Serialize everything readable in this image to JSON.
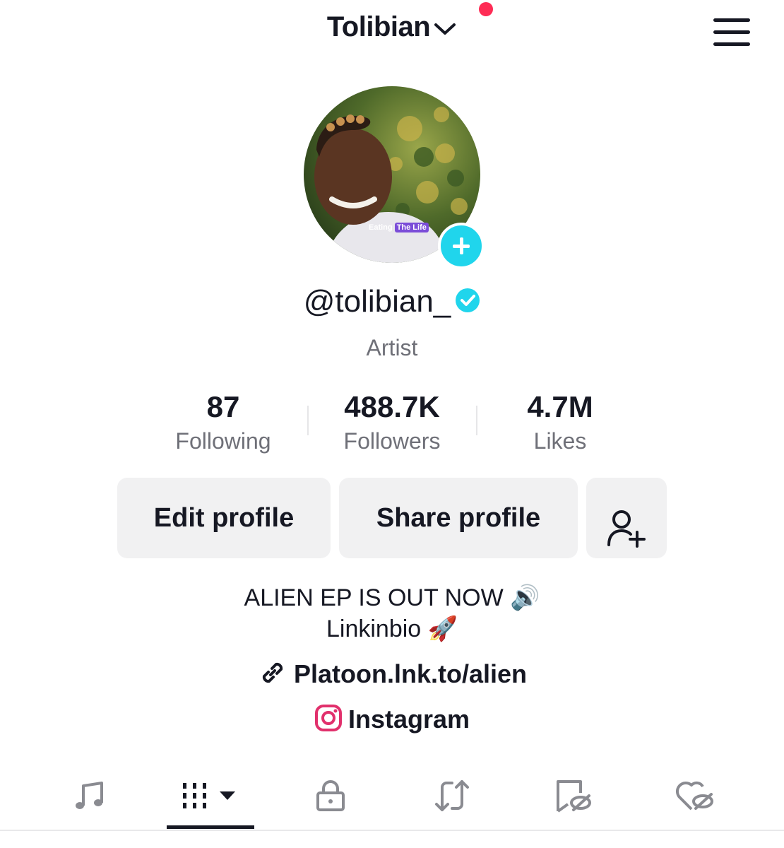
{
  "header": {
    "username": "Tolibian"
  },
  "avatar": {
    "caption_left": "Eating",
    "caption_badge": "The Life"
  },
  "profile": {
    "handle": "@tolibian_",
    "category": "Artist"
  },
  "stats": [
    {
      "value": "87",
      "label": "Following"
    },
    {
      "value": "488.7K",
      "label": "Followers"
    },
    {
      "value": "4.7M",
      "label": "Likes"
    }
  ],
  "actions": {
    "edit": "Edit profile",
    "share": "Share profile"
  },
  "bio": {
    "line1": "ALIEN EP IS OUT NOW 🔊",
    "line2": "Linkinbio 🚀"
  },
  "links": {
    "website": "Platoon.lnk.to/alien",
    "instagram": "Instagram"
  },
  "colors": {
    "accent": "#fe2c55",
    "add": "#20d5ec",
    "verified": "#20d5ec",
    "text": "#161823",
    "muted": "#6f7078"
  },
  "tabs": [
    "music-icon",
    "videos-grid-icon",
    "lock-icon",
    "repost-icon",
    "bookmark-hidden-icon",
    "liked-hidden-icon"
  ]
}
